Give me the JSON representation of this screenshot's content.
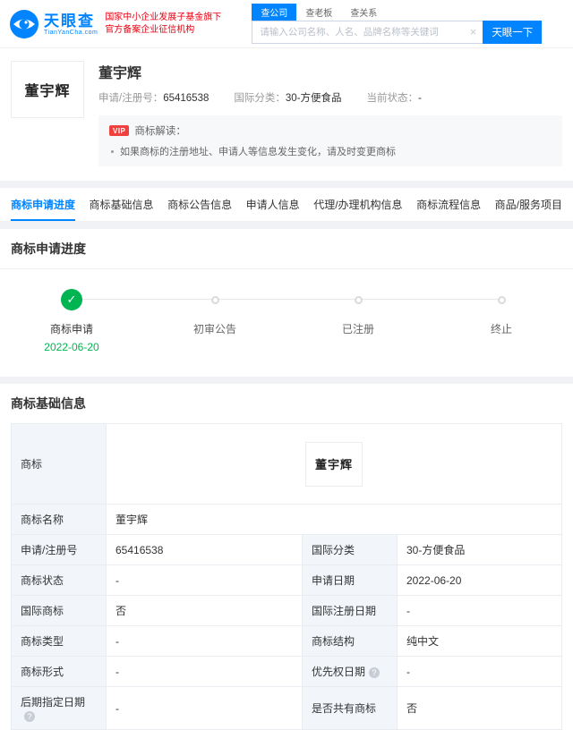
{
  "colors": {
    "brand_blue": "#0084ff",
    "brand_red": "#e60012",
    "success_green": "#00b551",
    "label_cell_bg": "#f2f6fb"
  },
  "icons": {
    "check": "✓",
    "clear": "×",
    "info": "?"
  },
  "header": {
    "logo": {
      "name": "天眼查",
      "domain": "TianYanCha.com"
    },
    "slogan_line1": "国家中小企业发展子基金旗下",
    "slogan_line2": "官方备案企业征信机构",
    "search": {
      "tabs": [
        {
          "label": "查公司"
        },
        {
          "label": "查老板"
        },
        {
          "label": "查关系"
        }
      ],
      "placeholder": "请输入公司名称、人名、品牌名称等关键词",
      "button": "天眼一下"
    }
  },
  "summary": {
    "trademark_text": "董宇辉",
    "title": "董宇辉",
    "fields": [
      {
        "label": "申请/注册号：",
        "value": "65416538"
      },
      {
        "label": "国际分类：",
        "value": "30-方便食品"
      },
      {
        "label": "当前状态：",
        "value": "-"
      }
    ],
    "insight": {
      "badge": "VIP",
      "title": "商标解读：",
      "bullet": "如果商标的注册地址、申请人等信息发生变化，请及时变更商标"
    }
  },
  "nav_tabs": [
    {
      "label": "商标申请进度"
    },
    {
      "label": "商标基础信息"
    },
    {
      "label": "商标公告信息"
    },
    {
      "label": "申请人信息"
    },
    {
      "label": "代理/办理机构信息"
    },
    {
      "label": "商标流程信息"
    },
    {
      "label": "商品/服务项目"
    }
  ],
  "progress": {
    "section_title": "商标申请进度",
    "steps": [
      {
        "label": "商标申请",
        "date": "2022-06-20"
      },
      {
        "label": "初审公告",
        "date": ""
      },
      {
        "label": "已注册",
        "date": ""
      },
      {
        "label": "终止",
        "date": ""
      }
    ]
  },
  "basic_info": {
    "section_title": "商标基础信息",
    "image_row": {
      "label": "商标",
      "image_text": "董宇辉"
    },
    "name_row": {
      "label": "商标名称",
      "value": "董宇辉"
    },
    "rows": [
      {
        "label1": "申请/注册号",
        "value1": "65416538",
        "label2": "国际分类",
        "value2": "30-方便食品"
      },
      {
        "label1": "商标状态",
        "value1": "-",
        "label2": "申请日期",
        "value2": "2022-06-20"
      },
      {
        "label1": "国际商标",
        "value1": "否",
        "label2": "国际注册日期",
        "value2": "-"
      },
      {
        "label1": "商标类型",
        "value1": "-",
        "label2": "商标结构",
        "value2": "纯中文"
      },
      {
        "label1": "商标形式",
        "value1": "-",
        "label2": "优先权日期",
        "value2": "-"
      },
      {
        "label1": "后期指定日期",
        "value1": "-",
        "label2": "是否共有商标",
        "value2": "否"
      }
    ]
  }
}
